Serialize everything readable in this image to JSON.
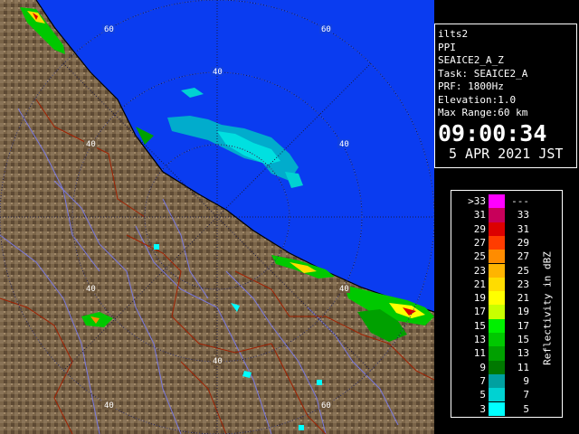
{
  "radar": {
    "rings_km": [
      20,
      40,
      60
    ],
    "ring_labels": [
      "60",
      "60",
      "40",
      "40",
      "40",
      "40",
      "40",
      "40",
      "40",
      "60"
    ]
  },
  "info_panel": {
    "station": "ilts2",
    "product": "PPI",
    "volume": "SEAICE2_A_Z",
    "task": "Task: SEAICE2_A",
    "prf": "PRF: 1800Hz",
    "elevation": "Elevation:1.0",
    "max_range": "Max Range:60 km",
    "time": "09:00:34",
    "date": "5 APR 2021 JST"
  },
  "legend": {
    "axis_title": "Reflectivity in dBZ",
    "rows": [
      {
        "left": ">33",
        "right": "---",
        "color": "#ff00ff"
      },
      {
        "left": "31",
        "right": "33",
        "color": "#c8005a"
      },
      {
        "left": "29",
        "right": "31",
        "color": "#dc0000"
      },
      {
        "left": "27",
        "right": "29",
        "color": "#ff3c00"
      },
      {
        "left": "25",
        "right": "27",
        "color": "#ff8c00"
      },
      {
        "left": "23",
        "right": "25",
        "color": "#ffb400"
      },
      {
        "left": "21",
        "right": "23",
        "color": "#ffdc00"
      },
      {
        "left": "19",
        "right": "21",
        "color": "#ffff00"
      },
      {
        "left": "17",
        "right": "19",
        "color": "#c8ff00"
      },
      {
        "left": "15",
        "right": "17",
        "color": "#00f000"
      },
      {
        "left": "13",
        "right": "15",
        "color": "#00c800"
      },
      {
        "left": "11",
        "right": "13",
        "color": "#00a000"
      },
      {
        "left": "9",
        "right": "11",
        "color": "#007800"
      },
      {
        "left": "7",
        "right": "9",
        "color": "#00a0a0"
      },
      {
        "left": "5",
        "right": "7",
        "color": "#00d2d2"
      },
      {
        "left": "3",
        "right": "5",
        "color": "#00ffff"
      }
    ]
  },
  "colors": {
    "sea": "#0a3cf0",
    "land": "#7a6448",
    "rivers": "#7a7ae0",
    "boundaries": "#a02000"
  }
}
